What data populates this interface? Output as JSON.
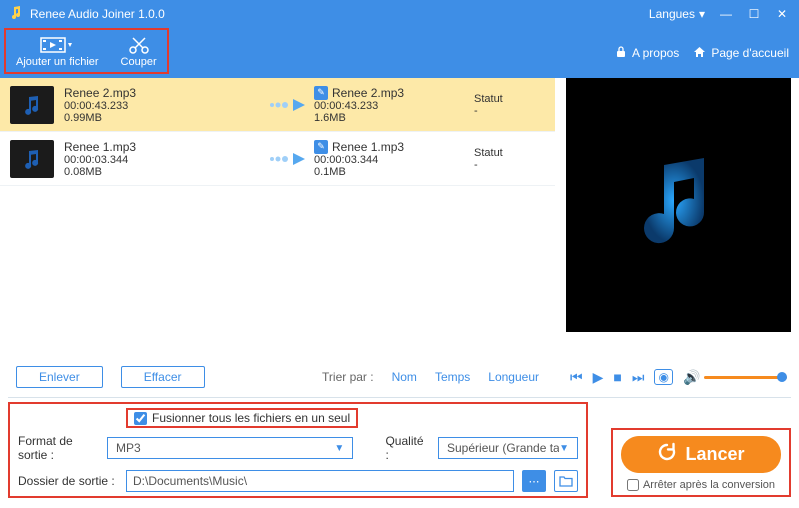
{
  "app": {
    "title": "Renee Audio Joiner 1.0.0"
  },
  "titlebar": {
    "language_label": "Langues",
    "minimize": "—",
    "maximize": "☐",
    "close": "✕"
  },
  "toolbar": {
    "add_file": "Ajouter un fichier",
    "cut": "Couper",
    "about": "A propos",
    "home": "Page d'accueil"
  },
  "files": [
    {
      "selected": true,
      "src_name": "Renee 2.mp3",
      "src_duration": "00:00:43.233",
      "src_size": "0.99MB",
      "dst_name": "Renee 2.mp3",
      "dst_duration": "00:00:43.233",
      "dst_size": "1.6MB",
      "status": "Statut",
      "status_value": "-"
    },
    {
      "selected": false,
      "src_name": "Renee 1.mp3",
      "src_duration": "00:00:03.344",
      "src_size": "0.08MB",
      "dst_name": "Renee 1.mp3",
      "dst_duration": "00:00:03.344",
      "dst_size": "0.1MB",
      "status": "Statut",
      "status_value": "-"
    }
  ],
  "midbar": {
    "remove": "Enlever",
    "clear": "Effacer",
    "sort_label": "Trier par :",
    "sort_name": "Nom",
    "sort_time": "Temps",
    "sort_length": "Longueur"
  },
  "settings": {
    "merge_label": "Fusionner tous les fichiers en un seul",
    "merge_checked": true,
    "format_label": "Format de sortie :",
    "format_value": "MP3",
    "quality_label": "Qualité :",
    "quality_value": "Supérieur (Grande ta",
    "folder_label": "Dossier de sortie :",
    "folder_value": "D:\\Documents\\Music\\"
  },
  "launch": {
    "button": "Lancer",
    "stop_after": "Arrêter après la conversion",
    "stop_checked": false
  }
}
